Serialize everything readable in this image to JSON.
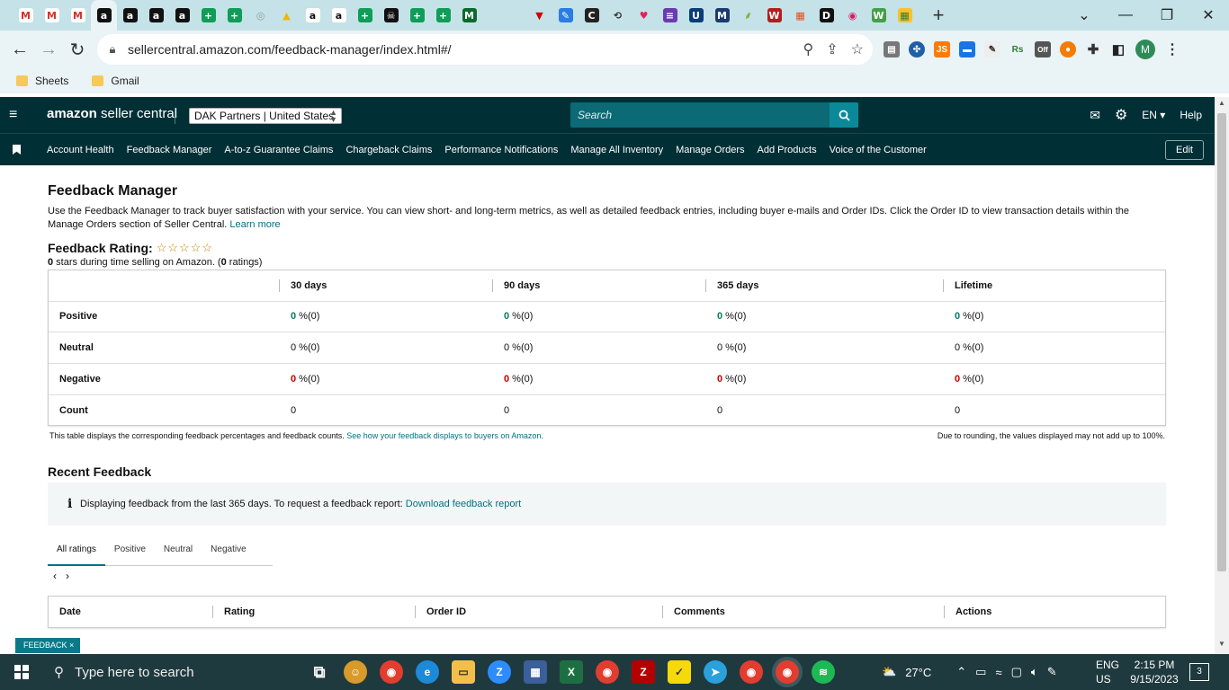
{
  "browser": {
    "tabs": [
      {
        "icon": "gmail-icon",
        "label": "M",
        "color": "#ffffff",
        "fg": "#d93025"
      },
      {
        "icon": "gmail-icon",
        "label": "M",
        "color": "#ffffff",
        "fg": "#d93025"
      },
      {
        "icon": "gmail-icon",
        "label": "M",
        "color": "#ffffff",
        "fg": "#d93025"
      },
      {
        "icon": "amazon-icon",
        "label": "a",
        "color": "#111111",
        "fg": "#ffffff",
        "active": true
      },
      {
        "icon": "amazon-icon",
        "label": "a",
        "color": "#111111",
        "fg": "#ffffff"
      },
      {
        "icon": "amazon-icon",
        "label": "a",
        "color": "#111111",
        "fg": "#ffffff"
      },
      {
        "icon": "amazon-icon",
        "label": "a",
        "color": "#111111",
        "fg": "#ffffff"
      },
      {
        "icon": "sheets-plus-icon",
        "label": "+",
        "color": "#0f9d58",
        "fg": "#ffffff"
      },
      {
        "icon": "sheets-plus-icon",
        "label": "+",
        "color": "#0f9d58",
        "fg": "#ffffff"
      },
      {
        "icon": "globe-icon",
        "label": "◎",
        "color": "#c4e2e7",
        "fg": "#999999"
      },
      {
        "icon": "drive-icon",
        "label": "▲",
        "color": "#c4e2e7",
        "fg": "#f4b400"
      },
      {
        "icon": "amazon-icon",
        "label": "a",
        "color": "#ffffff",
        "fg": "#111111"
      },
      {
        "icon": "amazon-icon",
        "label": "a",
        "color": "#ffffff",
        "fg": "#111111"
      },
      {
        "icon": "sheets-plus-icon",
        "label": "+",
        "color": "#0f9d58",
        "fg": "#ffffff"
      },
      {
        "icon": "pirate-icon",
        "label": "☠",
        "color": "#111111",
        "fg": "#ffffff"
      },
      {
        "icon": "sheets-plus-icon",
        "label": "+",
        "color": "#0f9d58",
        "fg": "#ffffff"
      },
      {
        "icon": "sheets-plus-icon",
        "label": "+",
        "color": "#0f9d58",
        "fg": "#ffffff"
      },
      {
        "icon": "m-icon",
        "label": "M",
        "color": "#0b6b2b",
        "fg": "#ffffff"
      },
      {
        "icon": "blank-icon",
        "label": "",
        "color": "#c4e2e7",
        "fg": "#c4e2e7"
      },
      {
        "icon": "triangle-icon",
        "label": "▼",
        "color": "#c4e2e7",
        "fg": "#cc0000"
      },
      {
        "icon": "pen-icon",
        "label": "✎",
        "color": "#2a7de1",
        "fg": "#ffffff"
      },
      {
        "icon": "c-icon",
        "label": "C",
        "color": "#222222",
        "fg": "#ffffff"
      },
      {
        "icon": "history-icon",
        "label": "⟲",
        "color": "#c4e2e7",
        "fg": "#333333"
      },
      {
        "icon": "heart-icon",
        "label": "♥",
        "color": "#c4e2e7",
        "fg": "#e0245e"
      },
      {
        "icon": "list-icon",
        "label": "≡",
        "color": "#6a3ab2",
        "fg": "#ffffff"
      },
      {
        "icon": "uline-icon",
        "label": "U",
        "color": "#0a3d78",
        "fg": "#ffffff"
      },
      {
        "icon": "m-icon",
        "label": "M",
        "color": "#1d3a6e",
        "fg": "#ffffff"
      },
      {
        "icon": "leaf-icon",
        "label": "⸙",
        "color": "#c4e2e7",
        "fg": "#7cb342"
      },
      {
        "icon": "w-icon",
        "label": "W",
        "color": "#b71c1c",
        "fg": "#ffffff"
      },
      {
        "icon": "grid-icon",
        "label": "▦",
        "color": "#c4e2e7",
        "fg": "#e64a19"
      },
      {
        "icon": "d-icon",
        "label": "D",
        "color": "#111111",
        "fg": "#ffffff"
      },
      {
        "icon": "lips-icon",
        "label": "◉",
        "color": "#c4e2e7",
        "fg": "#d81b60"
      },
      {
        "icon": "w-icon",
        "label": "W",
        "color": "#43a047",
        "fg": "#ffffff"
      },
      {
        "icon": "grid-icon",
        "label": "▦",
        "color": "#fbc02d",
        "fg": "#2e7d32"
      }
    ],
    "new_tab_label": "+",
    "window_controls": {
      "chevron": "⌄",
      "minimize": "—",
      "restore": "❐",
      "close": "✕"
    },
    "url": "sellercentral.amazon.com/feedback-manager/index.html#/",
    "profile_initial": "M",
    "extension_labels": {
      "js": "JS",
      "rs": "Rs",
      "off": "Off"
    },
    "bookmarks": [
      {
        "label": "Sheets"
      },
      {
        "label": "Gmail"
      }
    ]
  },
  "header": {
    "logo_main": "amazon",
    "logo_sub": " seller central",
    "account": "DAK Partners | United States",
    "search_placeholder": "Search",
    "language": "EN",
    "help": "Help"
  },
  "nav": {
    "links": [
      "Account Health",
      "Feedback Manager",
      "A-to-z Guarantee Claims",
      "Chargeback Claims",
      "Performance Notifications",
      "Manage All Inventory",
      "Manage Orders",
      "Add Products",
      "Voice of the Customer"
    ],
    "edit": "Edit"
  },
  "page": {
    "title": "Feedback Manager",
    "description": "Use the Feedback Manager to track buyer satisfaction with your service. You can view short- and long-term metrics, as well as detailed feedback entries, including buyer e-mails and Order IDs. Click the Order ID to view transaction details within the Manage Orders section of Seller Central.",
    "learn_more": "Learn more",
    "rating_heading": "Feedback Rating:",
    "stars": "☆☆☆☆☆",
    "rating_stars_value": "0",
    "rating_sub_mid": " stars during time selling on Amazon. (",
    "rating_count_value": "0",
    "rating_sub_end": " ratings)",
    "table": {
      "columns": [
        "30 days",
        "90 days",
        "365 days",
        "Lifetime"
      ],
      "rows": [
        {
          "label": "Positive",
          "values": [
            "0",
            "0",
            "0",
            "0"
          ],
          "suffix": " %(0)"
        },
        {
          "label": "Neutral",
          "values": [
            "0",
            "0",
            "0",
            "0"
          ],
          "suffix": " %(0)"
        },
        {
          "label": "Negative",
          "values": [
            "0",
            "0",
            "0",
            "0"
          ],
          "suffix": " %(0)"
        },
        {
          "label": "Count",
          "values": [
            "0",
            "0",
            "0",
            "0"
          ],
          "suffix": ""
        }
      ]
    },
    "note_left": "This table displays the corresponding feedback percentages and feedback counts.",
    "note_left_link": "See how your feedback displays to buyers on Amazon.",
    "note_right": "Due to rounding, the values displayed may not add up to 100%.",
    "recent_heading": "Recent Feedback",
    "info_text": "Displaying feedback from the last 365 days. To request a feedback report:",
    "info_link": "Download feedback report",
    "tabs": [
      "All ratings",
      "Positive",
      "Neutral",
      "Negative"
    ],
    "recent_columns": [
      "Date",
      "Rating",
      "Order ID",
      "Comments",
      "Actions"
    ],
    "feedback_tag": "FEEDBACK ×"
  },
  "taskbar": {
    "search_placeholder": "Type here to search",
    "temperature": "27°C",
    "lang1": "ENG",
    "lang2": "US",
    "time": "2:15 PM",
    "date": "9/15/2023",
    "notifications": "3"
  }
}
